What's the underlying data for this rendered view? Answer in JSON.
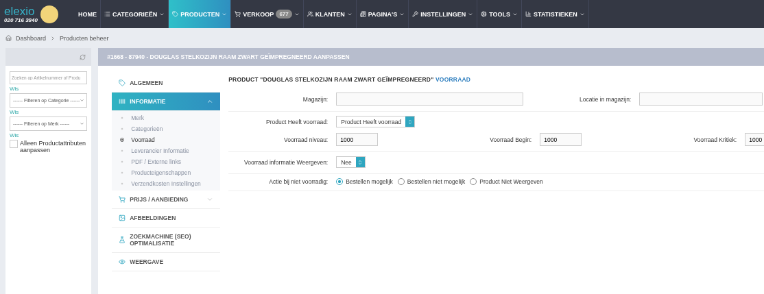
{
  "brand": {
    "name": "elexio",
    "phone": "020 716 3840"
  },
  "nav": [
    {
      "label": "HOME",
      "selected": false
    },
    {
      "label": "CATEGORIEËN",
      "selected": false
    },
    {
      "label": "PRODUCTEN",
      "selected": true
    },
    {
      "label": "VERKOOP",
      "selected": false,
      "badge": "677"
    },
    {
      "label": "KLANTEN",
      "selected": false
    },
    {
      "label": "PAGINA'S",
      "selected": false
    },
    {
      "label": "INSTELLINGEN",
      "selected": false
    },
    {
      "label": "TOOLS",
      "selected": false
    },
    {
      "label": "STATISTIEKEN",
      "selected": false
    }
  ],
  "breadcrumb": [
    "Dashboard",
    "Producten beheer"
  ],
  "filters": {
    "search": {
      "placeholder": "Zoeken op Artikelnummer of Produ"
    },
    "clear_links": [
      "Wis",
      "Wis",
      "Wis"
    ],
    "category": "------ Filteren op Categorie ------",
    "brand": "------ Filteren op Merk ------",
    "attributes_only": {
      "label": "Alleen Productattributen aanpassen",
      "checked": false
    }
  },
  "panel_title": "#1668 - 87940 - DOUGLAS STELKOZIJN RAAM ZWART GEÏMPREGNEERD AANPASSEN",
  "sections": [
    {
      "label": "ALGEMEEN",
      "selected": false
    },
    {
      "label": "INFORMATIE",
      "selected": true,
      "expanded": true,
      "children": [
        {
          "label": "Merk",
          "selected": false
        },
        {
          "label": "Categorieën",
          "selected": false
        },
        {
          "label": "Voorraad",
          "selected": true
        },
        {
          "label": "Leverancier Informatie",
          "selected": false
        },
        {
          "label": "PDF / Externe links",
          "selected": false
        },
        {
          "label": "Producteigenschappen",
          "selected": false
        },
        {
          "label": "Verzendkosten Instellingen",
          "selected": false
        }
      ]
    },
    {
      "label": "PRIJS / AANBIEDING",
      "selected": false,
      "expanded": false
    },
    {
      "label": "AFBEELDINGEN",
      "selected": false
    },
    {
      "label": "ZOEKMACHINE (SEO) OPTIMALISATIE",
      "selected": false
    },
    {
      "label": "WEERGAVE",
      "selected": false
    }
  ],
  "form": {
    "title": "PRODUCT \"DOUGLAS STELKOZIJN RAAM ZWART GEÏMPREGNEERD\"",
    "title_accent": "VOORRAAD",
    "warehouse": {
      "label": "Magazijn:"
    },
    "location": {
      "label": "Locatie in magazijn:"
    },
    "has_stock": {
      "label": "Product Heeft voorraad:",
      "value": "Product Heeft voorraad"
    },
    "stock_level": {
      "label": "Voorraad niveau:",
      "value": "1000"
    },
    "stock_start": {
      "label": "Voorraad Begin:",
      "value": "1000"
    },
    "stock_critical": {
      "label": "Voorraad Kritiek:",
      "value": "1000"
    },
    "show_stock_info": {
      "label": "Voorraad informatie Weergeven:",
      "value": "Nee"
    },
    "out_of_stock": {
      "label": "Actie bij niet voorradig:",
      "options": [
        {
          "label": "Bestellen mogelijk",
          "selected": true
        },
        {
          "label": "Bestellen niet mogelijk",
          "selected": false
        },
        {
          "label": "Product Niet Weergeven",
          "selected": false
        }
      ]
    }
  }
}
